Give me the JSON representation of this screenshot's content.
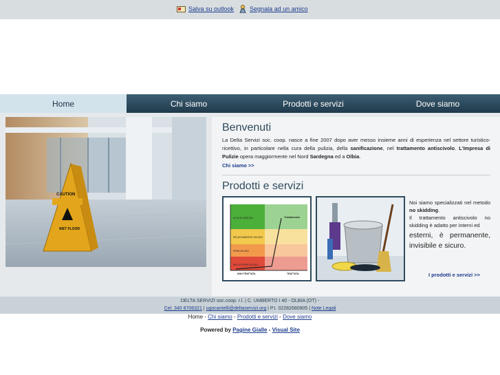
{
  "topbar": {
    "save_outlook": "Salva su outlook",
    "tell_friend": "Segnala ad un amico"
  },
  "nav": {
    "items": [
      {
        "label": "Home"
      },
      {
        "label": "Chi siamo"
      },
      {
        "label": "Prodotti e servizi"
      },
      {
        "label": "Dove siamo"
      }
    ]
  },
  "photo": {
    "sign_text_1": "CAUTION",
    "sign_text_2": "WET FLOOR"
  },
  "welcome": {
    "title": "Benvenuti",
    "p1": "La Delta Servizi soc. coop. nasce a fine 2007 dopo aver messo insieme anni di esperienza nel settore turistico-ricettivo, in particolare nella cura della pulizia, della ",
    "b1": "sanificazione",
    "p2": ", nel ",
    "b2": "trattamento antiscivolo",
    "p3": ". ",
    "b3": "L'Impresa di Pulizie",
    "p4": " opera maggiormente nel Nord ",
    "b4": "Sardegna",
    "p5": " ed a ",
    "b5": "Olbia",
    "p6": ".",
    "more": "Chi siamo >>"
  },
  "products": {
    "title": "Prodotti e servizi",
    "chart_labels": {
      "high": "ALTA SICUREZZA",
      "treatment": "Trattamento",
      "medium": "RELATIVAMENTE SICURO",
      "danger": "PERICOLOSO",
      "very_danger": "MOLTO PERICOLOSO",
      "untreated": "NON TRATTATA",
      "treated": "TRATTATA"
    },
    "desc1_a": "Noi siamo specializzati nel metodo ",
    "desc1_b": "no skidding",
    "desc1_c": ".",
    "desc2": "Il trattamento antiscivolo no skidding è adatto per interni ed",
    "desc3": "esterni, è permanente, invisibile e sicuro.",
    "more": "I prodotti e servizi >>"
  },
  "footer": {
    "line1": "DELTA SERVIZI soc.coop. r.l. | C. UMBERTO I 40 - OLBIA (OT) -",
    "phone": "Cel. 340 8706321",
    "email": "ugocantelli@deltaservizi.org",
    "piva": " | P.I. 02282680905 | ",
    "legal": "Note Legali",
    "sep": " | "
  },
  "bottomnav": {
    "home": "Home",
    "sep": " - ",
    "chi": "Chi siamo",
    "prodotti": "Prodotti e servizi",
    "dove": "Dove siamo"
  },
  "powered": {
    "label": "Powered by ",
    "pg": "Pagine Gialle",
    "dash": " - ",
    "vs": "Visual Site"
  },
  "colors": {
    "nav_dark": "#2e4a5c",
    "nav_active": "#d2e3ec",
    "link": "#1b3a8c"
  }
}
